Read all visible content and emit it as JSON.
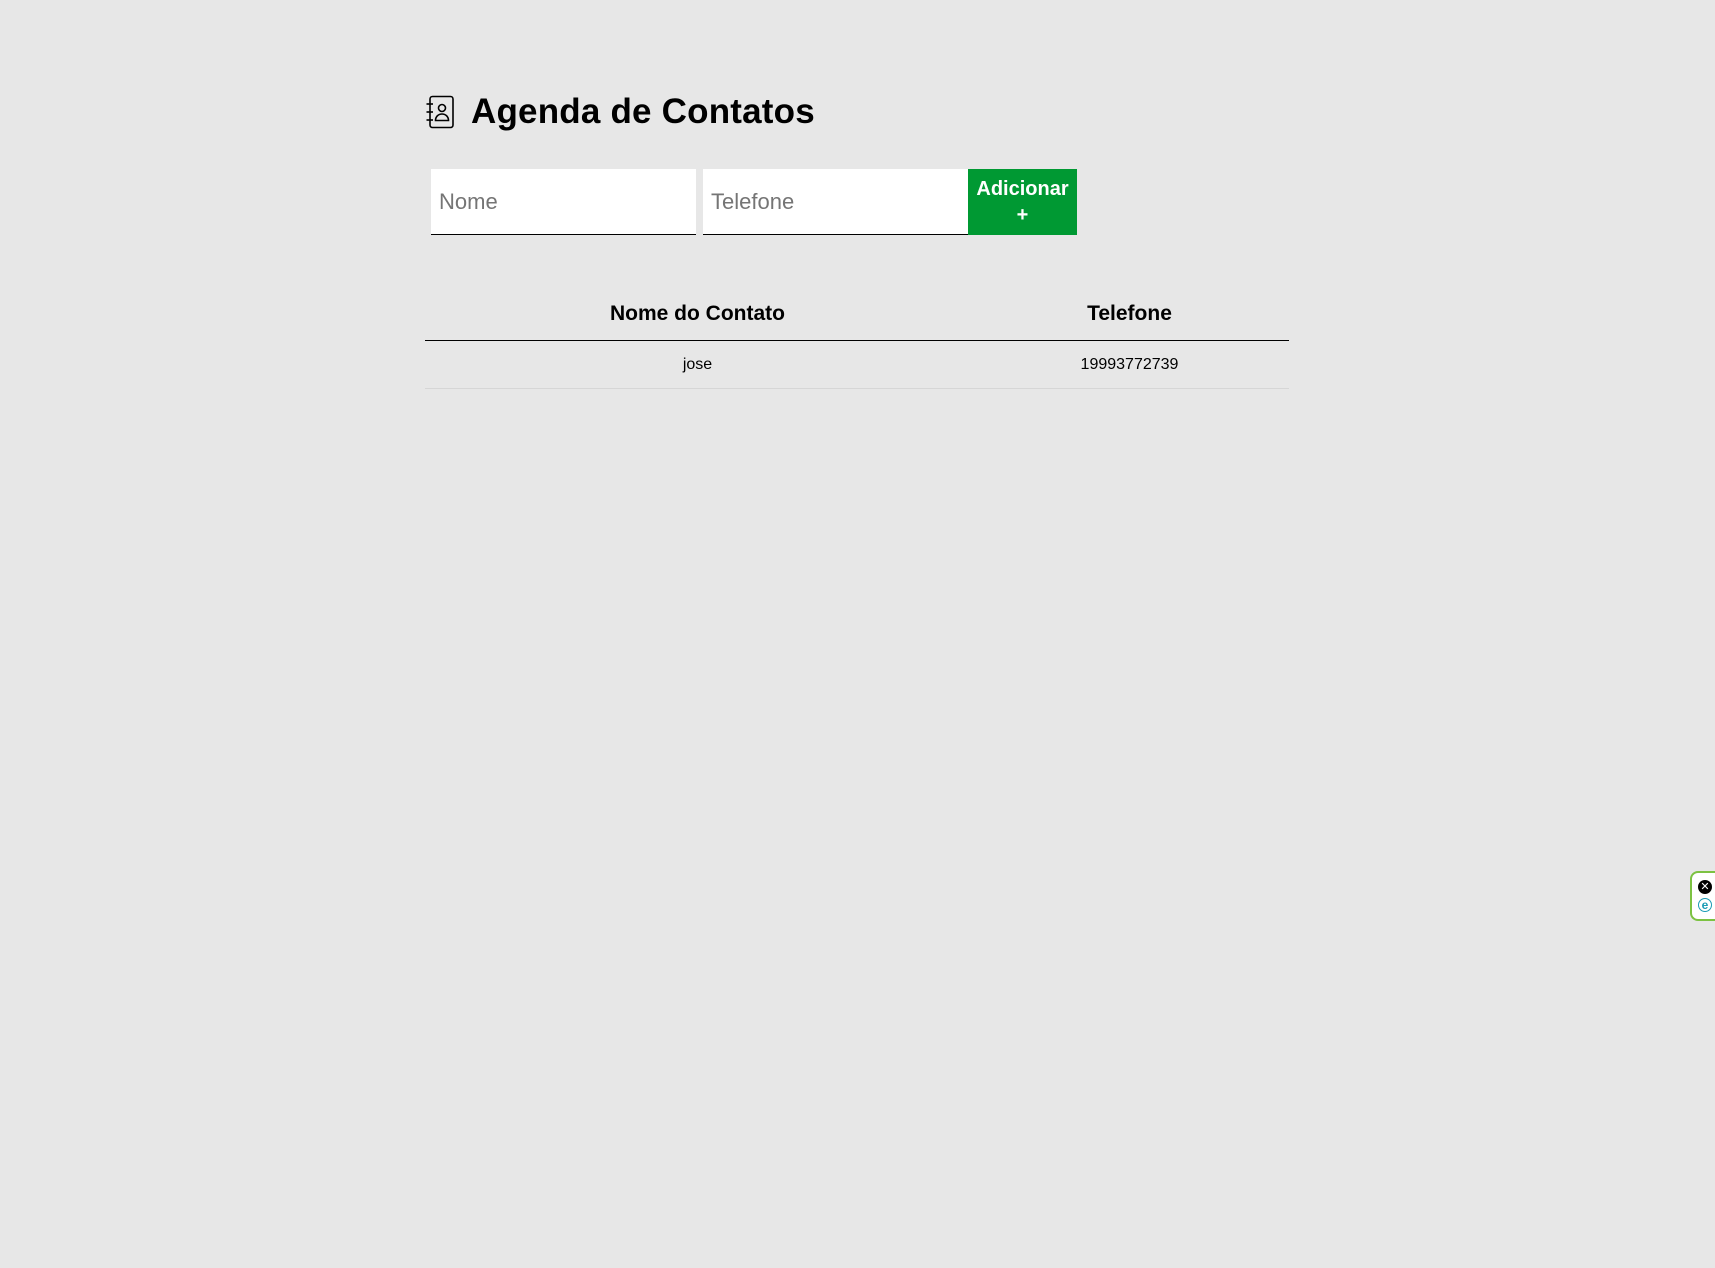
{
  "header": {
    "title": "Agenda de Contatos",
    "icon": "address-book-icon"
  },
  "form": {
    "name_placeholder": "Nome",
    "name_value": "",
    "phone_placeholder": "Telefone",
    "phone_value": "",
    "add_label_line1": "Adicionar",
    "add_label_line2": "+",
    "add_color": "#009933"
  },
  "table": {
    "headers": [
      "Nome do Contato",
      "Telefone"
    ],
    "rows": [
      {
        "name": "jose",
        "phone": "19993772739"
      }
    ]
  },
  "side_widget": {
    "close_icon": "close-circle-icon",
    "close_glyph": "✕",
    "ext_icon": "extension-e-icon",
    "ext_glyph": "e",
    "accent": "#7cc242"
  },
  "colors": {
    "background": "#e7e7e7",
    "button": "#009933"
  }
}
